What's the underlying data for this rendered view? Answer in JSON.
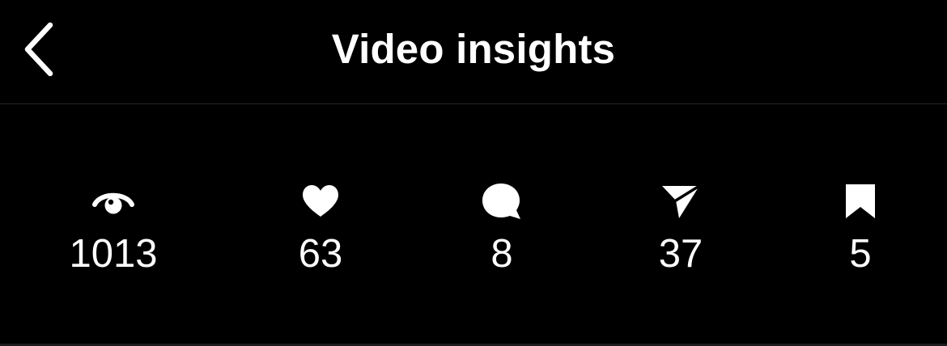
{
  "header": {
    "title": "Video insights",
    "back_icon": "chevron-left-icon"
  },
  "stats": [
    {
      "icon": "eye-icon",
      "value": "1013"
    },
    {
      "icon": "heart-icon",
      "value": "63"
    },
    {
      "icon": "comment-icon",
      "value": "8"
    },
    {
      "icon": "share-icon",
      "value": "37"
    },
    {
      "icon": "bookmark-icon",
      "value": "5"
    }
  ],
  "colors": {
    "background": "#000000",
    "text": "#ffffff",
    "divider": "#262626"
  }
}
